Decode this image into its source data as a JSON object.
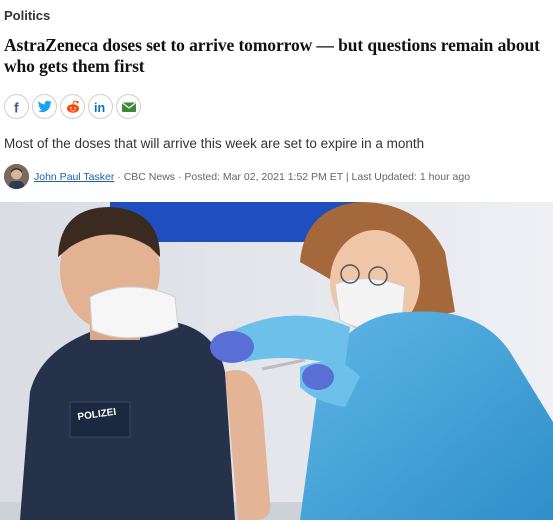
{
  "section": {
    "label": "Politics"
  },
  "article": {
    "headline": "AstraZeneca doses set to arrive tomorrow — but questions remain about who gets them first",
    "deck": "Most of the doses that will arrive this week are set to expire in a month"
  },
  "share": {
    "buttons": [
      {
        "icon": "facebook-icon",
        "glyph": "f",
        "color": "#3b5998"
      },
      {
        "icon": "twitter-icon",
        "glyph": "",
        "color": "#1da1f2"
      },
      {
        "icon": "reddit-icon",
        "glyph": "",
        "color": "#ff4500"
      },
      {
        "icon": "linkedin-icon",
        "glyph": "in",
        "color": "#0077b5"
      },
      {
        "icon": "email-icon",
        "glyph": "",
        "color": "#3a8a3a"
      }
    ]
  },
  "byline": {
    "author": "John Paul Tasker",
    "source": "CBC News",
    "posted": "Posted: Mar 02, 2021 1:52 PM ET",
    "updated": "Last Updated: 1 hour ago"
  },
  "photo": {
    "uniform_text": "POLIZEI"
  }
}
